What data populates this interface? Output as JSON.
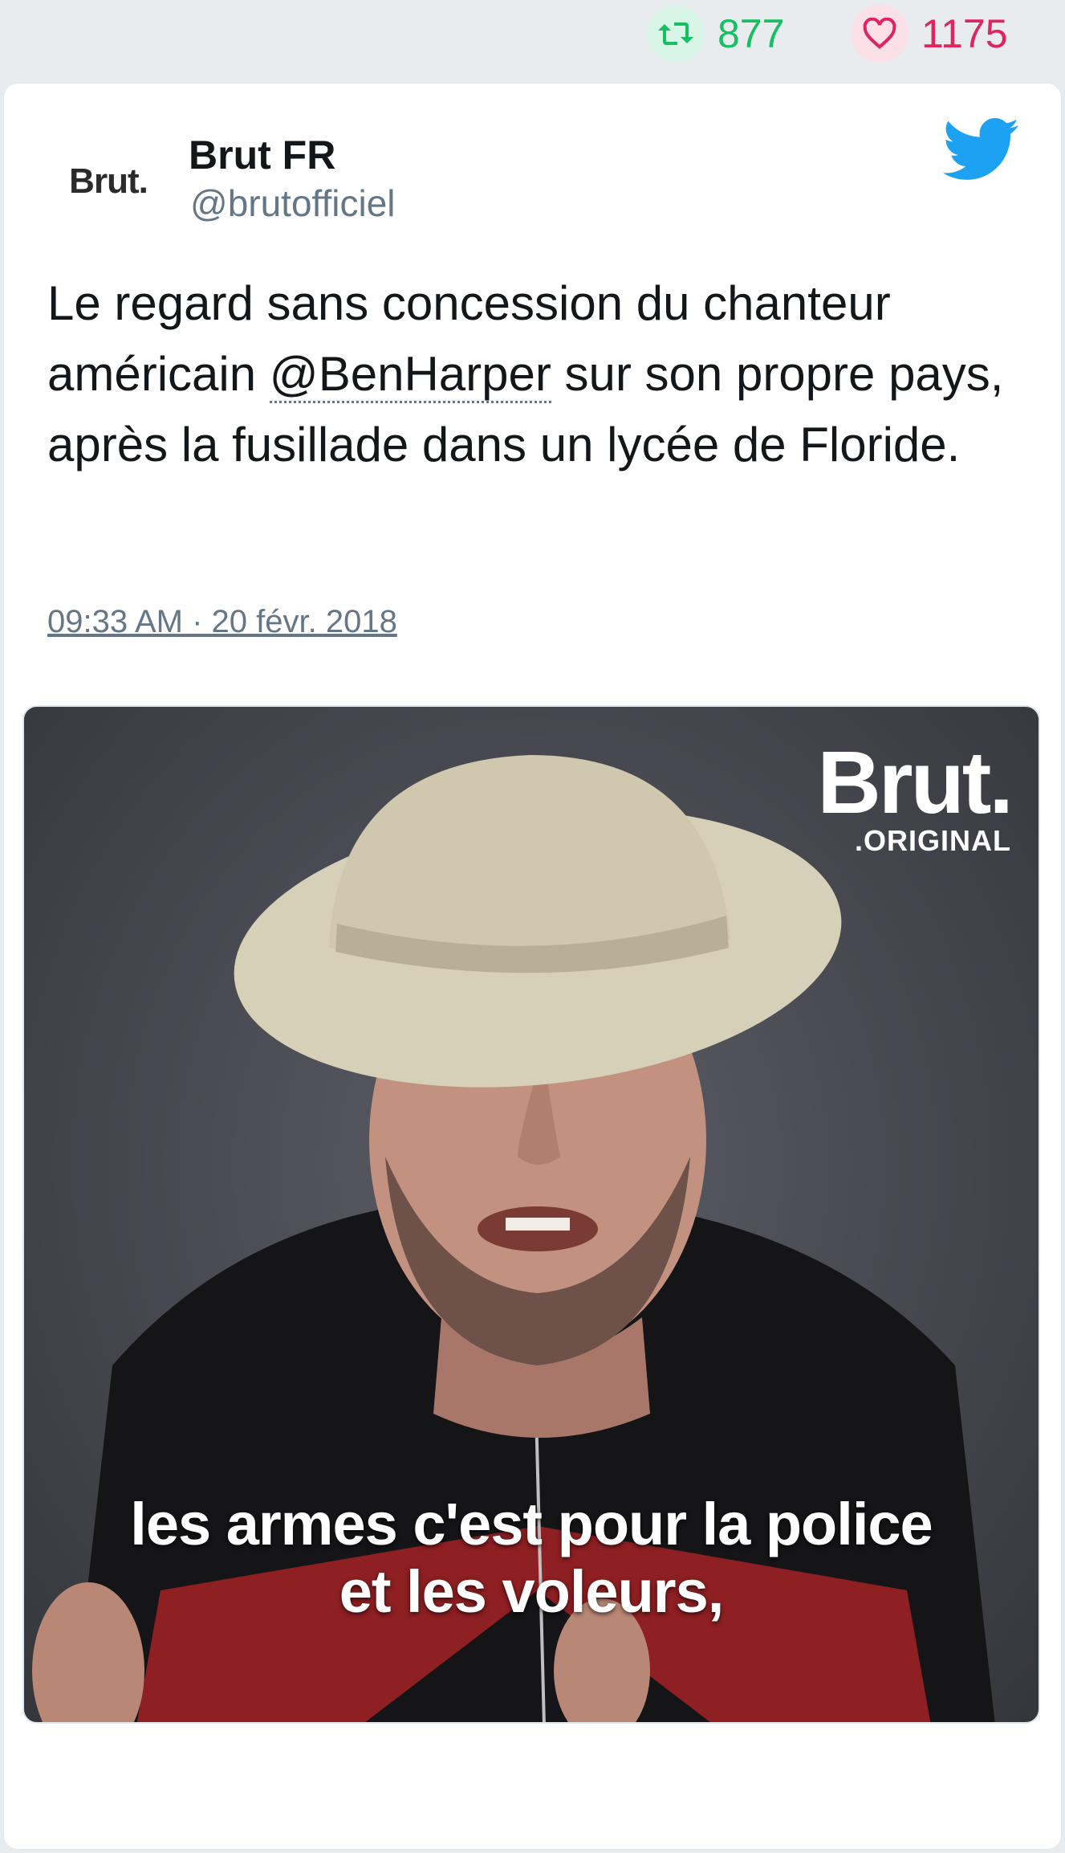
{
  "stats": {
    "retweets": "877",
    "likes": "1175",
    "retweet_icon": "retweet-icon",
    "like_icon": "heart-icon",
    "retweet_color": "#17bf63",
    "like_color": "#e0245e"
  },
  "tweet": {
    "avatar_text": "Brut.",
    "author_name": "Brut FR",
    "author_handle": "@brutofficiel",
    "platform_icon": "twitter-bird-icon",
    "text_before": "Le regard sans concession du chanteur américain ",
    "mention": "@BenHarper",
    "text_after": " sur son propre pays, après la fusillade dans un lycée de Floride.",
    "timestamp": "09:33 AM · 20 févr. 2018",
    "actions": [
      "reply-icon",
      "retweet-icon",
      "heart-icon"
    ]
  },
  "media": {
    "brand_main": "Brut.",
    "brand_sub": ".ORIGINAL",
    "subtitle_line1": "les armes c'est pour la police",
    "subtitle_line2": "et les voleurs,"
  }
}
